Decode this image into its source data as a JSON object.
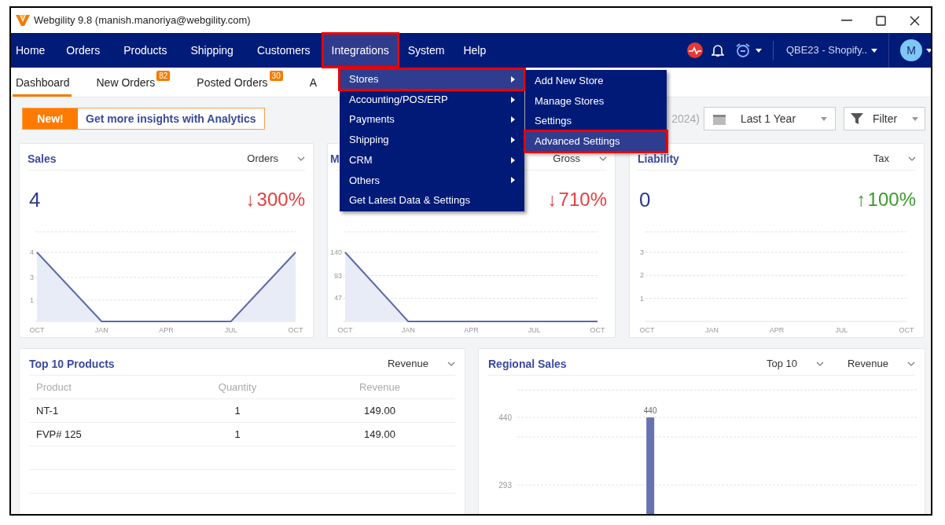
{
  "window": {
    "title": "Webgility 9.8 (manish.manoriya@webgility.com)"
  },
  "nav": {
    "items": [
      {
        "label": "Home",
        "selected": false,
        "marked": false
      },
      {
        "label": "Orders",
        "selected": false,
        "marked": false
      },
      {
        "label": "Products",
        "selected": false,
        "marked": false
      },
      {
        "label": "Shipping",
        "selected": false,
        "marked": false
      },
      {
        "label": "Customers",
        "selected": false,
        "marked": false
      },
      {
        "label": "Integrations",
        "selected": true,
        "marked": true
      },
      {
        "label": "System",
        "selected": false,
        "marked": false
      },
      {
        "label": "Help",
        "selected": false,
        "marked": false
      }
    ],
    "store": "QBE23 - Shopify..",
    "avatar": "M"
  },
  "tabs": [
    {
      "label": "Dashboard",
      "selected": true
    },
    {
      "label": "New Orders",
      "badge": "82",
      "selected": false
    },
    {
      "label": "Posted Orders",
      "badge": "30",
      "selected": false
    },
    {
      "label": "A",
      "selected": false
    }
  ],
  "banner": {
    "tag": "New!",
    "text": "Get more insights with Analytics"
  },
  "toolbar": {
    "date_range": "2024)",
    "period": "Last 1 Year",
    "filter": "Filter"
  },
  "kpi_cards": [
    {
      "title": "Sales",
      "metric": "Orders",
      "value": "4",
      "arrow": "↓",
      "change": "300%",
      "color": "#e53e3e",
      "chart_data": {
        "type": "area",
        "categories": [
          "OCT",
          "JAN",
          "APR",
          "JUL",
          "OCT"
        ],
        "values": [
          4,
          0,
          0,
          0,
          4
        ],
        "ylim": [
          0,
          4
        ],
        "yticks": [
          {
            "value": 1.23,
            "label": "1"
          },
          {
            "value": 2.55,
            "label": "3"
          },
          4
        ],
        "grid": true
      }
    },
    {
      "title": "M",
      "metric": "Gross",
      "arrow": "↓",
      "change": "710%",
      "color": "#e53e3e",
      "chart_data": {
        "type": "area",
        "categories": [
          "OCT",
          "JAN",
          "APR",
          "JUL",
          "OCT"
        ],
        "values": [
          140,
          0,
          0,
          0,
          0
        ],
        "ylim": [
          0,
          140
        ],
        "yticks": [
          47,
          93,
          140
        ],
        "grid": true
      }
    },
    {
      "title": "Liability",
      "metric": "Tax",
      "value": "0",
      "arrow": "↑",
      "change": "100%",
      "color": "#3a9a2a",
      "chart_data": {
        "type": "line",
        "categories": [
          "OCT",
          "JAN",
          "APR",
          "JUL",
          "OCT"
        ],
        "ylim": [
          0,
          3
        ],
        "yticks": [
          1,
          2,
          3
        ],
        "grid": true
      }
    }
  ],
  "top_products": {
    "title": "Top 10 Products",
    "metric": "Revenue",
    "columns": [
      "Product",
      "Quantity",
      "Revenue"
    ],
    "rows": [
      [
        "NT-1",
        "1",
        "149.00"
      ],
      [
        "FVP# 125",
        "1",
        "149.00"
      ]
    ]
  },
  "regional_sales": {
    "title": "Regional Sales",
    "limit": "Top 10",
    "metric": "Revenue",
    "chart_data": {
      "type": "bar",
      "values": [
        null,
        null,
        null,
        440,
        null,
        null,
        null,
        null,
        null,
        null
      ],
      "ylim": [
        0,
        500
      ],
      "yticks": [
        293,
        440
      ],
      "data_labels": true
    }
  },
  "menu": {
    "items": [
      {
        "label": "Stores",
        "submenu": true,
        "selected": true,
        "marked": true
      },
      {
        "label": "Accounting/POS/ERP",
        "submenu": true,
        "selected": false,
        "marked": false
      },
      {
        "label": "Payments",
        "submenu": true,
        "selected": false,
        "marked": false
      },
      {
        "label": "Shipping",
        "submenu": true,
        "selected": false,
        "marked": false
      },
      {
        "label": "CRM",
        "submenu": true,
        "selected": false,
        "marked": false
      },
      {
        "label": "Others",
        "submenu": true,
        "selected": false,
        "marked": false
      },
      {
        "label": "Get Latest Data & Settings",
        "submenu": false,
        "selected": false,
        "marked": false
      }
    ]
  },
  "submenu": {
    "items": [
      {
        "label": "Add New Store",
        "selected": false,
        "marked": false
      },
      {
        "label": "Manage Stores",
        "selected": false,
        "marked": false
      },
      {
        "label": "Settings",
        "selected": false,
        "marked": false
      },
      {
        "label": "Advanced Settings",
        "selected": true,
        "marked": true
      }
    ]
  }
}
